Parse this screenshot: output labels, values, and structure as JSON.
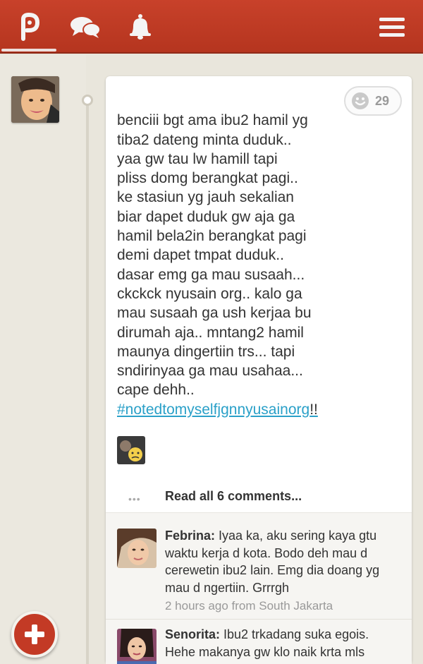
{
  "nav": {
    "items": [
      "path-logo-icon",
      "chat-icon",
      "bell-icon",
      "menu-icon"
    ]
  },
  "post": {
    "text": "benciii bgt ama ibu2 hamil yg\ntiba2 dateng minta duduk..\nyaa gw tau lw hamill tapi\npliss domg berangkat pagi..\nke stasiun yg jauh sekalian\nbiar dapet duduk gw aja ga\nhamil bela2in berangkat pagi\ndemi dapet tmpat duduk..\ndasar emg ga mau susaah...\nckckck nyusain org.. kalo ga\nmau susaah ga ush kerjaa bu\ndirumah aja.. mntang2 hamil\nmaunya dingertiin trs... tapi\nsndirinyaa ga mau usahaa...\ncape dehh..",
    "hashtag": "#notedtomyselfjgnnyusainorg",
    "hashtag_tail": "!!",
    "smile_count": "29"
  },
  "comments": {
    "read_all_label": "Read all 6 comments...",
    "items": [
      {
        "name": "Febrina:",
        "text": " Iyaa ka, aku sering kaya gtu waktu kerja d kota. Bodo deh mau d cerewetin ibu2 lain. Emg dia doang yg mau d ngertiin. Grrrgh",
        "meta": "2 hours ago from South Jakarta"
      },
      {
        "name": "Senorita:",
        "text": " Ibu2 trkadang suka egois. Hehe makanya gw klo naik krta mls"
      }
    ]
  },
  "colors": {
    "brand": "#c33a25",
    "link": "#2aa0c8"
  }
}
